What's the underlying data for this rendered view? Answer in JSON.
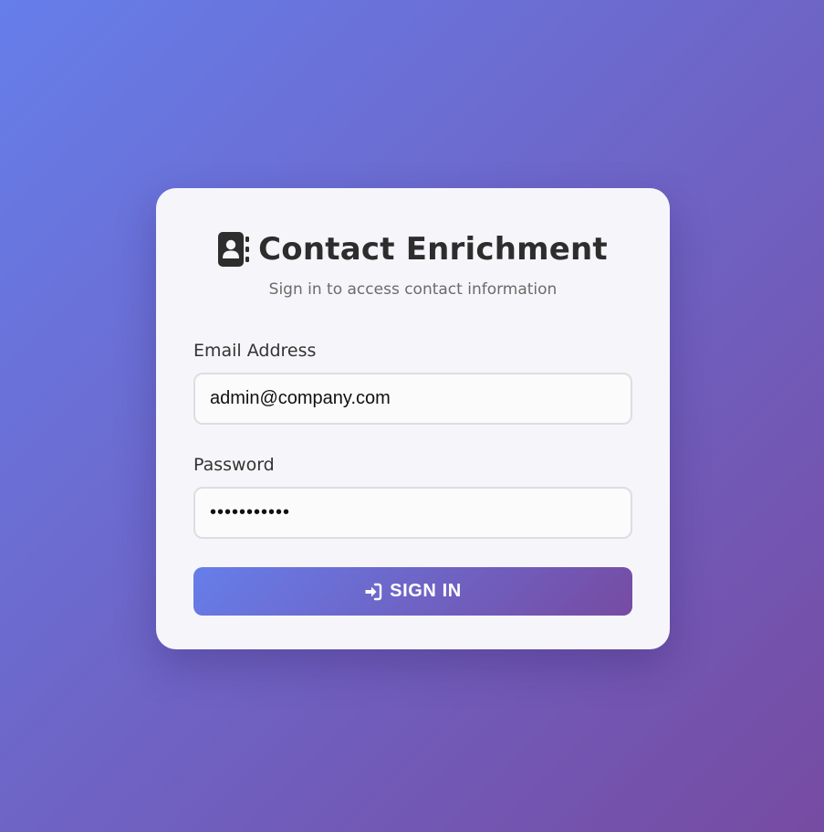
{
  "header": {
    "title": "Contact Enrichment",
    "title_icon": "address-book-icon",
    "subtitle": "Sign in to access contact information"
  },
  "form": {
    "email": {
      "label": "Email Address",
      "value": "admin@company.com"
    },
    "password": {
      "label": "Password",
      "masked_value": "•••••••••••"
    },
    "submit": {
      "label": "SIGN IN",
      "icon": "sign-in-icon"
    }
  },
  "colors": {
    "gradient_start": "#667eea",
    "gradient_end": "#764ba2",
    "card_background": "#f6f6fa",
    "title_text": "#2d2d2d"
  }
}
